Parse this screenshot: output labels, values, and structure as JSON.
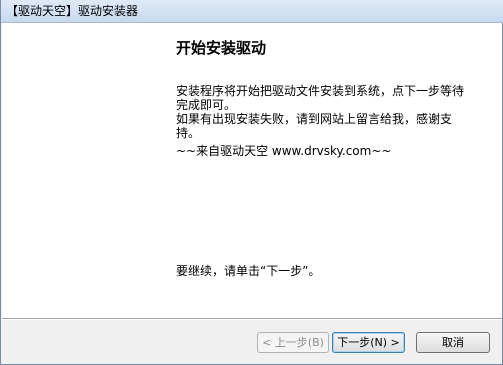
{
  "window": {
    "title": "【驱动天空】驱动安装器"
  },
  "page": {
    "heading": "开始安装驱动",
    "description_lines": [
      "安装程序将开始把驱动文件安装到系统，点下一步等待完成即可。",
      "如果有出现安装失败，请到网站上留言给我，感谢支持。"
    ],
    "credit": "~~来自驱动天空 www.drvsky.com~~",
    "continue_prompt": "要继续，请单击“下一步”。"
  },
  "buttons": {
    "back": "< 上一步(B)",
    "next": "下一步(N) >",
    "cancel": "取消"
  }
}
